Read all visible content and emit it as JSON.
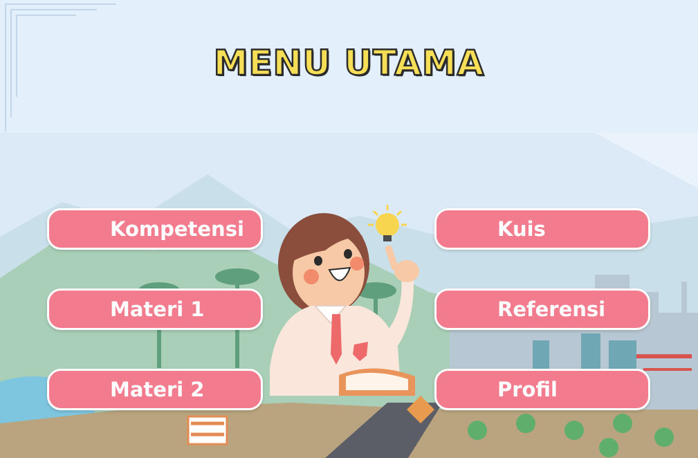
{
  "header": {
    "title": "MENU UTAMA"
  },
  "menu": {
    "kompetensi": "Kompetensi",
    "materi_1": "Materi 1",
    "materi_2": "Materi 2",
    "kuis": "Kuis",
    "referensi": "Referensi",
    "profil": "Profil"
  },
  "colors": {
    "button": "#f27b8d",
    "title_fill": "#f6df56",
    "header_bg": "#e3f0fc"
  }
}
